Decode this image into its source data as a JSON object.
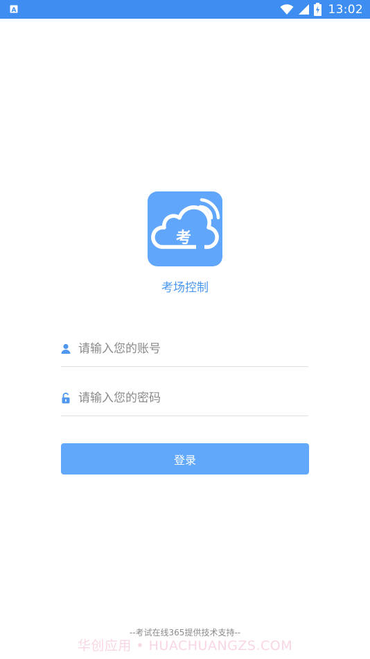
{
  "status_bar": {
    "time": "13:02",
    "app_icon": "a-notification-icon",
    "icons": [
      "wifi-icon",
      "signal-icon",
      "battery-charging-icon"
    ]
  },
  "app": {
    "logo_char": "考",
    "title": "考场控制"
  },
  "form": {
    "account_placeholder": "请输入您的账号",
    "password_placeholder": "请输入您的密码",
    "account_icon": "user-icon",
    "password_icon": "lock-icon",
    "login_label": "登录"
  },
  "footer": {
    "note": "--考试在线365提供技术支持--",
    "watermark": "华创应用 • HUACHUANGZS.COM"
  },
  "colors": {
    "status_bar": "#3d8ef0",
    "accent": "#61a8fb",
    "title_text": "#4a97ef"
  }
}
